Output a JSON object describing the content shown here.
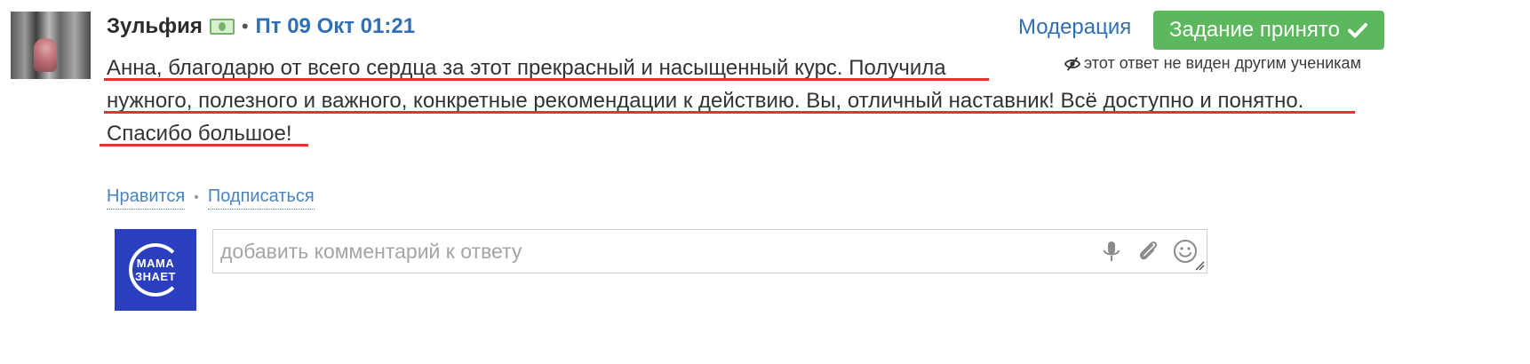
{
  "post": {
    "author": "Зульфия",
    "separator": "•",
    "date": "Пт 09 Окт 01:21",
    "moderation_label": "Модерация",
    "accepted_label": "Задание принято",
    "hidden_note": "этот ответ не виден другим ученикам",
    "answer_lines": [
      "Анна, благодарю от всего сердца за этот прекрасный и насыщенный курс. Получила",
      "нужного, полезного и важного, конкретные рекомендации к действию. Вы, отличный наставник! Всё доступно и понятно.",
      "Спасибо большое!"
    ],
    "highlight_color": "#e0342c"
  },
  "actions": {
    "like_label": "Нравится",
    "bullet": "•",
    "subscribe_label": "Подписаться"
  },
  "brand": {
    "line1": "МАМА",
    "line2": "ЗНАЕТ"
  },
  "comment": {
    "placeholder": "добавить комментарий к ответу",
    "value": "",
    "icons": [
      "microphone-icon",
      "paperclip-icon",
      "smiley-icon",
      "resize-handle-icon"
    ]
  },
  "colors": {
    "link": "#2f6fb4",
    "accepted_bg": "#5cb85c",
    "brand_bg": "#2a3fbf"
  }
}
